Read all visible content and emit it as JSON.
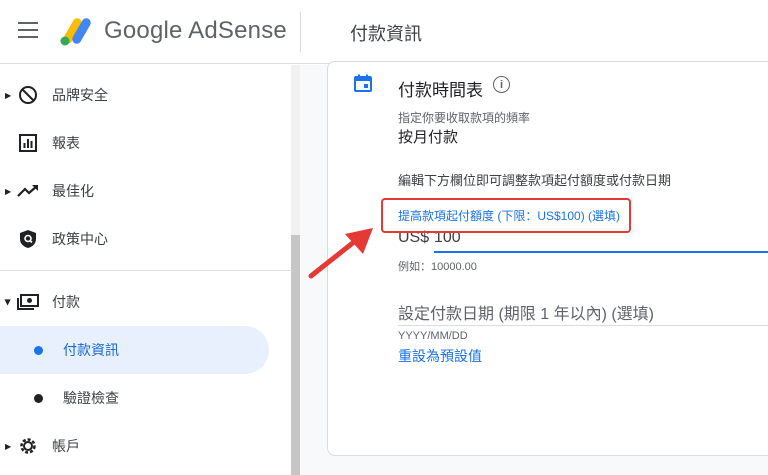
{
  "header": {
    "logo_text": "Google AdSense",
    "page_title": "付款資訊"
  },
  "sidebar": {
    "items": [
      {
        "label": "品牌安全",
        "icon": "block-icon"
      },
      {
        "label": "報表",
        "icon": "report-icon"
      },
      {
        "label": "最佳化",
        "icon": "trending-up-icon"
      },
      {
        "label": "政策中心",
        "icon": "shield-icon"
      },
      {
        "label": "付款",
        "icon": "payments-icon"
      },
      {
        "label": "付款資訊",
        "icon": "dot",
        "active": true
      },
      {
        "label": "驗證檢查",
        "icon": "dot"
      },
      {
        "label": "帳戶",
        "icon": "gear-icon"
      }
    ]
  },
  "card": {
    "title": "付款時間表",
    "freq_label": "指定你要收取款項的頻率",
    "freq_value": "按月付款",
    "edit_desc": "編輯下方欄位即可調整款項起付額度或付款日期",
    "threshold_label": "提高款項起付額度 (下限：US$100) (選填)",
    "amount_prefix": "US$",
    "amount_value": "100",
    "example": "例如：10000.00",
    "date_label": "設定付款日期 (期限 1 年以內) (選填)",
    "date_format": "YYYY/MM/DD",
    "reset_link": "重設為預設值"
  },
  "colors": {
    "accent": "#1a73e8",
    "highlight": "#e53935"
  }
}
